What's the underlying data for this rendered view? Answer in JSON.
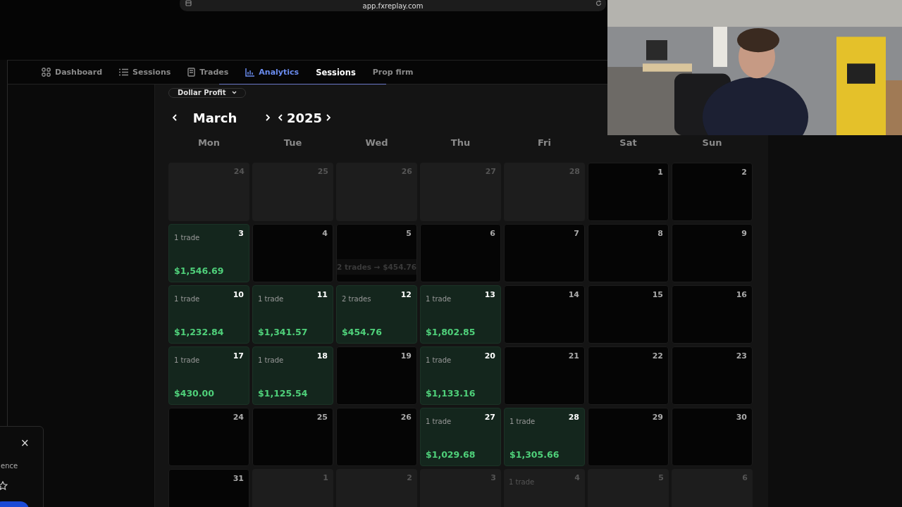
{
  "browser": {
    "url": "app.fxreplay.com"
  },
  "nav": [
    {
      "label": "Dashboard",
      "selected": false,
      "highlighted": false
    },
    {
      "label": "Sessions",
      "selected": false,
      "highlighted": false
    },
    {
      "label": "Trades",
      "selected": false,
      "highlighted": false
    },
    {
      "label": "Analytics",
      "selected": true,
      "highlighted": false
    },
    {
      "label": "Sessions",
      "selected": false,
      "highlighted": true
    },
    {
      "label": "Prop firm",
      "selected": false,
      "highlighted": false
    }
  ],
  "metric_dropdown": {
    "value": "Dollar Profit"
  },
  "calendar": {
    "month": "March",
    "year": "2025",
    "weekdays": [
      "Mon",
      "Tue",
      "Wed",
      "Thu",
      "Fri",
      "Sat",
      "Sun"
    ],
    "days": [
      {
        "day": "24",
        "kind": "outside"
      },
      {
        "day": "25",
        "kind": "outside"
      },
      {
        "day": "26",
        "kind": "outside"
      },
      {
        "day": "27",
        "kind": "outside"
      },
      {
        "day": "28",
        "kind": "outside"
      },
      {
        "day": "1",
        "kind": "empty"
      },
      {
        "day": "2",
        "kind": "empty"
      },
      {
        "day": "3",
        "kind": "profit",
        "trades": "1 trade",
        "pnl": "$1,546.69"
      },
      {
        "day": "4",
        "kind": "empty"
      },
      {
        "day": "5",
        "kind": "empty",
        "tooltip": "2 trades → $454.76"
      },
      {
        "day": "6",
        "kind": "empty"
      },
      {
        "day": "7",
        "kind": "empty"
      },
      {
        "day": "8",
        "kind": "empty"
      },
      {
        "day": "9",
        "kind": "empty"
      },
      {
        "day": "10",
        "kind": "profit",
        "trades": "1 trade",
        "pnl": "$1,232.84"
      },
      {
        "day": "11",
        "kind": "profit",
        "trades": "1 trade",
        "pnl": "$1,341.57"
      },
      {
        "day": "12",
        "kind": "profit",
        "trades": "2 trades",
        "pnl": "$454.76"
      },
      {
        "day": "13",
        "kind": "profit",
        "trades": "1 trade",
        "pnl": "$1,802.85"
      },
      {
        "day": "14",
        "kind": "empty"
      },
      {
        "day": "15",
        "kind": "empty"
      },
      {
        "day": "16",
        "kind": "empty"
      },
      {
        "day": "17",
        "kind": "profit",
        "trades": "1 trade",
        "pnl": "$430.00"
      },
      {
        "day": "18",
        "kind": "profit",
        "trades": "1 trade",
        "pnl": "$1,125.54"
      },
      {
        "day": "19",
        "kind": "empty"
      },
      {
        "day": "20",
        "kind": "profit",
        "trades": "1 trade",
        "pnl": "$1,133.16"
      },
      {
        "day": "21",
        "kind": "empty"
      },
      {
        "day": "22",
        "kind": "empty"
      },
      {
        "day": "23",
        "kind": "empty"
      },
      {
        "day": "24",
        "kind": "empty"
      },
      {
        "day": "25",
        "kind": "empty"
      },
      {
        "day": "26",
        "kind": "empty"
      },
      {
        "day": "27",
        "kind": "profit",
        "trades": "1 trade",
        "pnl": "$1,029.68"
      },
      {
        "day": "28",
        "kind": "profit",
        "trades": "1 trade",
        "pnl": "$1,305.66"
      },
      {
        "day": "29",
        "kind": "empty"
      },
      {
        "day": "30",
        "kind": "empty"
      },
      {
        "day": "31",
        "kind": "empty"
      },
      {
        "day": "1",
        "kind": "outside"
      },
      {
        "day": "2",
        "kind": "outside"
      },
      {
        "day": "3",
        "kind": "outside"
      },
      {
        "day": "4",
        "kind": "outside",
        "trades": "1 trade"
      },
      {
        "day": "5",
        "kind": "outside"
      },
      {
        "day": "6",
        "kind": "outside"
      }
    ]
  },
  "toast": {
    "close": "×",
    "text": "ence"
  }
}
